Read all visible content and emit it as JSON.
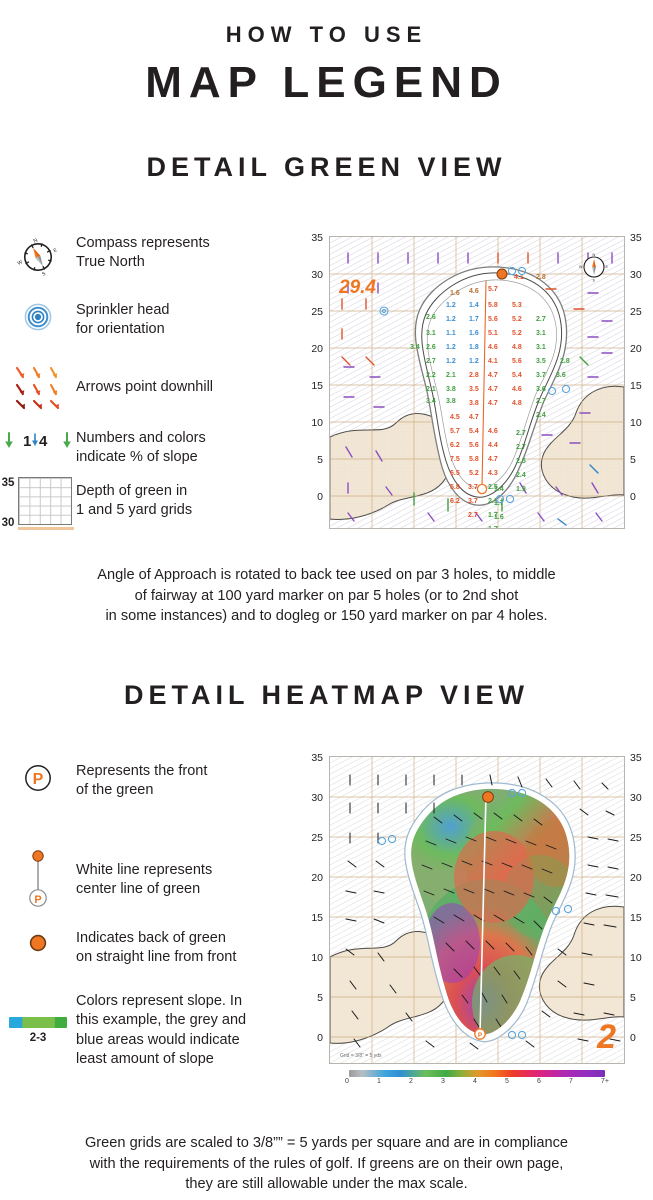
{
  "header": {
    "kicker": "HOW TO USE",
    "title": "MAP LEGEND"
  },
  "sections": [
    {
      "id": "detail-green-view",
      "heading": "DETAIL GREEN VIEW",
      "legend_items": [
        {
          "icon": "compass-icon",
          "line1": "Compass represents",
          "line2": "True North"
        },
        {
          "icon": "sprinkler-head-icon",
          "line1": "Sprinkler head",
          "line2": "for orientation"
        },
        {
          "icon": "downhill-arrows-icon",
          "line1": "Arrows point downhill",
          "line2": ""
        },
        {
          "icon": "slope-number-icon",
          "line1": "Numbers and colors",
          "line2": "indicate % of slope"
        },
        {
          "icon": "depth-grid-icon",
          "line1": "Depth of green in",
          "line2": "1 and 5 yard grids"
        }
      ],
      "caption": [
        "Angle of Approach is rotated to back tee used on par 3 holes, to middle",
        "of fairway at 100 yard marker on par 5 holes (or to 2nd shot",
        "in some instances) and to dogleg or 150 yard marker on par 4 holes."
      ]
    },
    {
      "id": "detail-heatmap-view",
      "heading": "DETAIL HEATMAP VIEW",
      "legend_items": [
        {
          "icon": "front-of-green-icon",
          "line1": "Represents the front",
          "line2": "of the green",
          "line3": "",
          "line4": ""
        },
        {
          "icon": "center-line-icon",
          "line1": "White line represents",
          "line2": "center line of green",
          "line3": "",
          "line4": ""
        },
        {
          "icon": "back-of-green-icon",
          "line1": "Indicates back of green",
          "line2": "on straight line from front",
          "line3": "",
          "line4": ""
        },
        {
          "icon": "slope-color-swatch-icon",
          "line1": "Colors represent slope. In",
          "line2": "this example, the grey and",
          "line3": "blue areas would indicate",
          "line4": "least amount of slope"
        }
      ],
      "swatch_label": "2-3",
      "caption": [
        "Green grids are scaled to 3/8”” = 5 yards per square and are in compliance",
        "with the requirements of the rules of golf. If greens are on their own page,",
        "they are still allowable under the max scale."
      ]
    }
  ],
  "green_map": {
    "axis_left": [
      "35",
      "30",
      "25",
      "20",
      "15",
      "10",
      "5",
      "0"
    ],
    "axis_right": [
      "35",
      "30",
      "25",
      "20",
      "15",
      "10",
      "5",
      "0"
    ],
    "distance_label": "29.4",
    "compass_labels": {
      "n": "N",
      "e": "E",
      "s": "S",
      "w": "W"
    }
  },
  "heatmap": {
    "axis_left": [
      "35",
      "30",
      "25",
      "20",
      "15",
      "10",
      "5",
      "0"
    ],
    "axis_right": [
      "35",
      "30",
      "25",
      "20",
      "15",
      "10",
      "5",
      "0"
    ],
    "hole_number": "2",
    "scale_note": "Grid = 3/8” = 5 yds",
    "front_marker": "P",
    "colorbar_labels": [
      "0",
      "1",
      "2",
      "3",
      "4",
      "5",
      "6",
      "7",
      "7+"
    ]
  },
  "depth_grid": {
    "top": "35",
    "bottom": "30"
  },
  "slope_example": {
    "value": "1.4"
  },
  "colors": {
    "accent_orange": "#ef7622",
    "text": "#231f20",
    "sprinkler_blue": "#2f82c6",
    "grass_tan": "#f2e6d4",
    "slope_green": "#4aa94a"
  }
}
